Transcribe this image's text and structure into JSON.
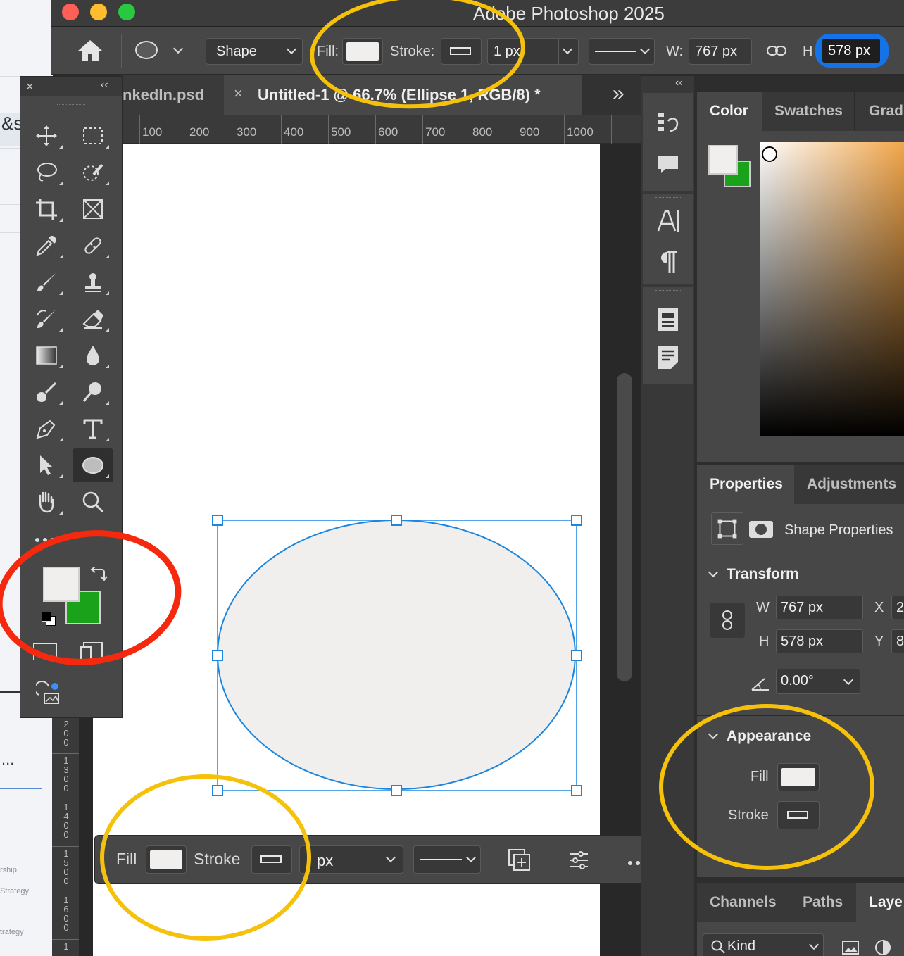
{
  "app": {
    "title": "Adobe Photoshop 2025"
  },
  "options_bar": {
    "mode": "Shape",
    "fill_label": "Fill:",
    "stroke_label": "Stroke:",
    "stroke_width": "1 px",
    "w_label": "W:",
    "w_value": "767 px",
    "h_label": "H",
    "h_value": "578 px"
  },
  "tabs": [
    {
      "label": "nkedIn.psd"
    },
    {
      "label": "Untitled-1 @ 66.7% (Ellipse 1, RGB/8) *",
      "close": "×"
    }
  ],
  "tabs_overflow": "»",
  "ruler": {
    "h_ticks": [
      "100",
      "200",
      "300",
      "400",
      "500",
      "600",
      "700",
      "800",
      "900",
      "1000"
    ],
    "v_ticks": [
      "200",
      "1300",
      "1400",
      "1500",
      "1600",
      "1"
    ]
  },
  "background_window": {
    "snippet": "&s",
    "ellipsis": "...",
    "labels": [
      "rship",
      "Strategy",
      "trategy"
    ]
  },
  "contextual_bar": {
    "fill_label": "Fill",
    "stroke_label": "Stroke",
    "width_unit": "px"
  },
  "color_panel": {
    "tabs": [
      "Color",
      "Swatches",
      "Grad"
    ],
    "foreground": "#f0efed",
    "background": "#1aa31a"
  },
  "properties_panel": {
    "tabs": [
      "Properties",
      "Adjustments"
    ],
    "kind": "Shape Properties",
    "transform": {
      "title": "Transform",
      "w_label": "W",
      "w_value": "767 px",
      "h_label": "H",
      "h_value": "578 px",
      "x_label": "X",
      "x_value": "2",
      "y_label": "Y",
      "y_value": "8",
      "angle": "0.00°"
    },
    "appearance": {
      "title": "Appearance",
      "fill_label": "Fill",
      "stroke_label": "Stroke"
    }
  },
  "bottom_panel": {
    "tabs": [
      "Channels",
      "Paths",
      "Laye"
    ],
    "filter_label": "Kind"
  },
  "colors": {
    "selection_blue": "#1a86e0",
    "annotation_yellow": "#f5c10a",
    "annotation_red": "#f5290e",
    "ellipse_fill": "#f1efed"
  }
}
